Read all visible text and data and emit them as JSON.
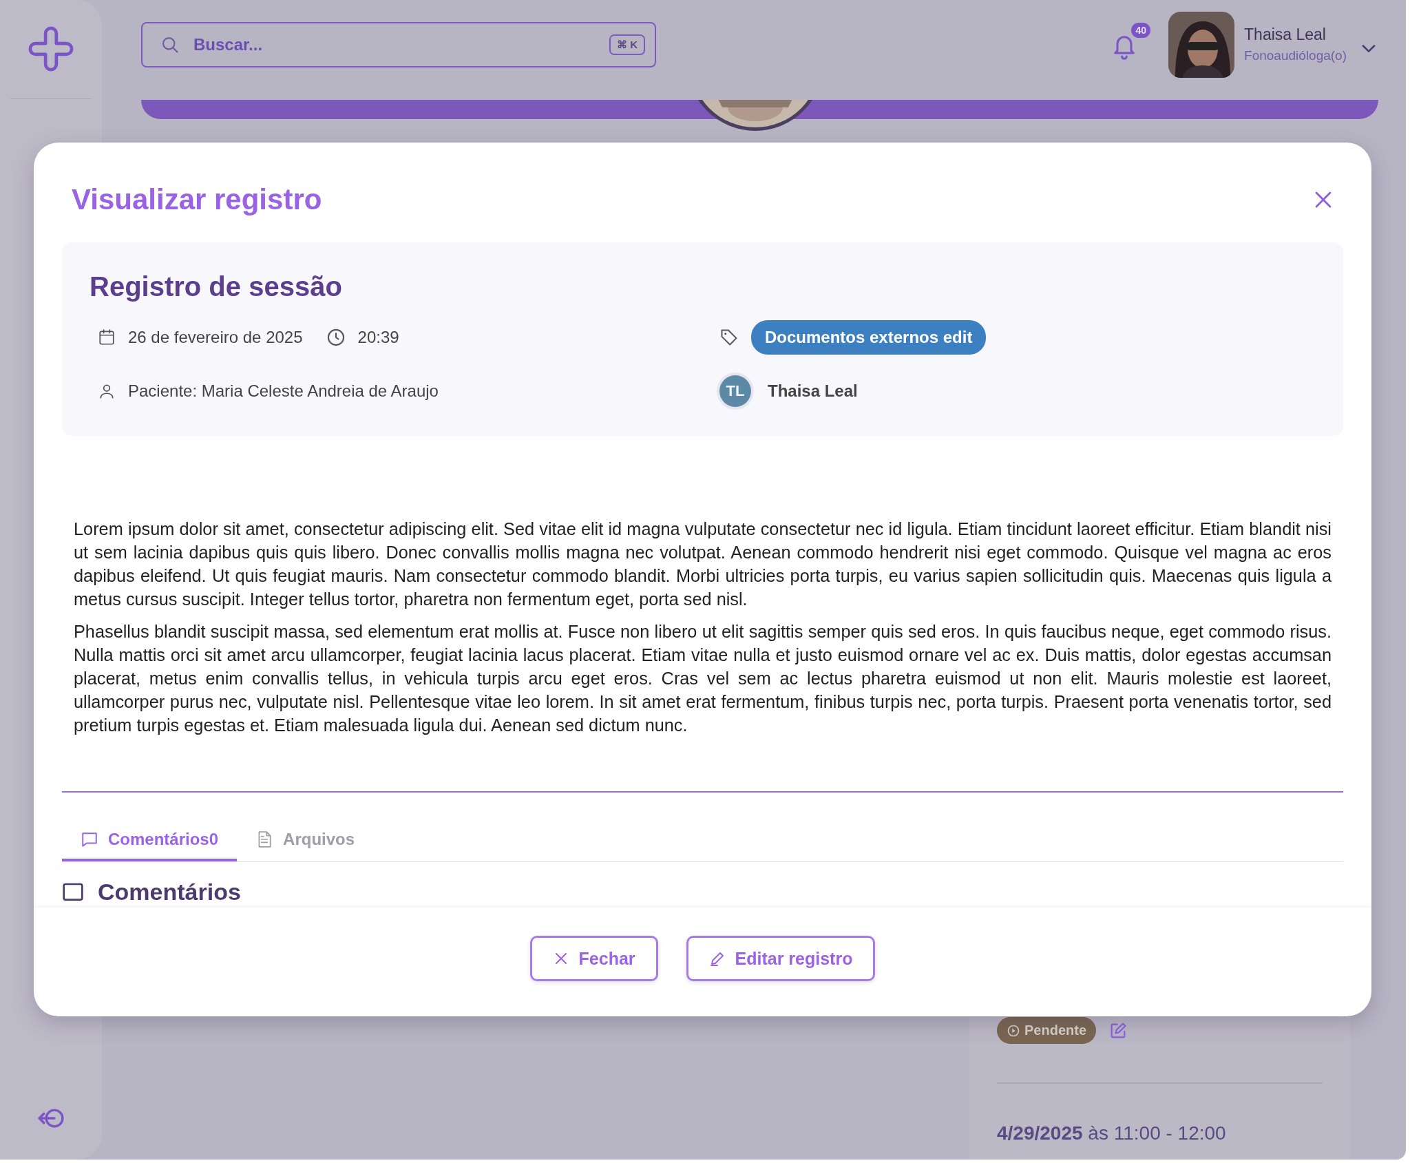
{
  "search": {
    "placeholder": "Buscar...",
    "shortcut": "⌘ K"
  },
  "notifications": {
    "count": "40"
  },
  "user": {
    "name": "Thaisa Leal",
    "role": "Fonoaudióloga(o)"
  },
  "modal": {
    "title": "Visualizar registro",
    "record": {
      "title": "Registro de sessão",
      "date": "26 de fevereiro de 2025",
      "time": "20:39",
      "tag": "Documentos externos edit",
      "patient": "Paciente: Maria Celeste Andreia de Araujo",
      "author": {
        "initials": "TL",
        "name": "Thaisa Leal"
      }
    },
    "body": [
      "Lorem ipsum dolor sit amet, consectetur adipiscing elit. Sed vitae elit id magna vulputate consectetur nec id ligula. Etiam tincidunt laoreet efficitur. Etiam blandit nisi ut sem lacinia dapibus quis quis libero. Donec convallis mollis magna nec volutpat. Aenean commodo hendrerit nisi eget commodo. Quisque vel magna ac eros dapibus eleifend. Ut quis feugiat mauris. Nam consectetur commodo blandit. Morbi ultricies porta turpis, eu varius sapien sollicitudin quis. Maecenas quis ligula a metus cursus suscipit. Integer tellus tortor, pharetra non fermentum eget, porta sed nisl.",
      "Phasellus blandit suscipit massa, sed elementum erat mollis at. Fusce non libero ut elit sagittis semper quis sed eros. In quis faucibus neque, eget commodo risus. Nulla mattis orci sit amet arcu ullamcorper, feugiat lacinia lacus placerat. Etiam vitae nulla et justo euismod ornare vel ac ex. Duis mattis, dolor egestas accumsan placerat, metus enim convallis tellus, in vehicula turpis arcu eget eros. Cras vel sem ac lectus pharetra euismod ut non elit. Mauris molestie est laoreet, ullamcorper purus nec, vulputate nisl. Pellentesque vitae leo lorem. In sit amet erat fermentum, finibus turpis nec, porta turpis. Praesent porta venenatis tortor, sed pretium turpis egestas et. Etiam malesuada ligula dui. Aenean sed dictum nunc."
    ],
    "tabs": [
      {
        "label": "Comentários0",
        "kind": "comments",
        "selected": true
      },
      {
        "label": "Arquivos",
        "kind": "files",
        "selected": false
      }
    ],
    "section_heading": "Comentários",
    "buttons": [
      {
        "label": "Fechar",
        "kind": "close"
      },
      {
        "label": "Editar registro",
        "kind": "edit"
      }
    ]
  },
  "appointment": {
    "status": "Pendente",
    "when": "**4/29/2025** às 11:00 - 12:00"
  }
}
